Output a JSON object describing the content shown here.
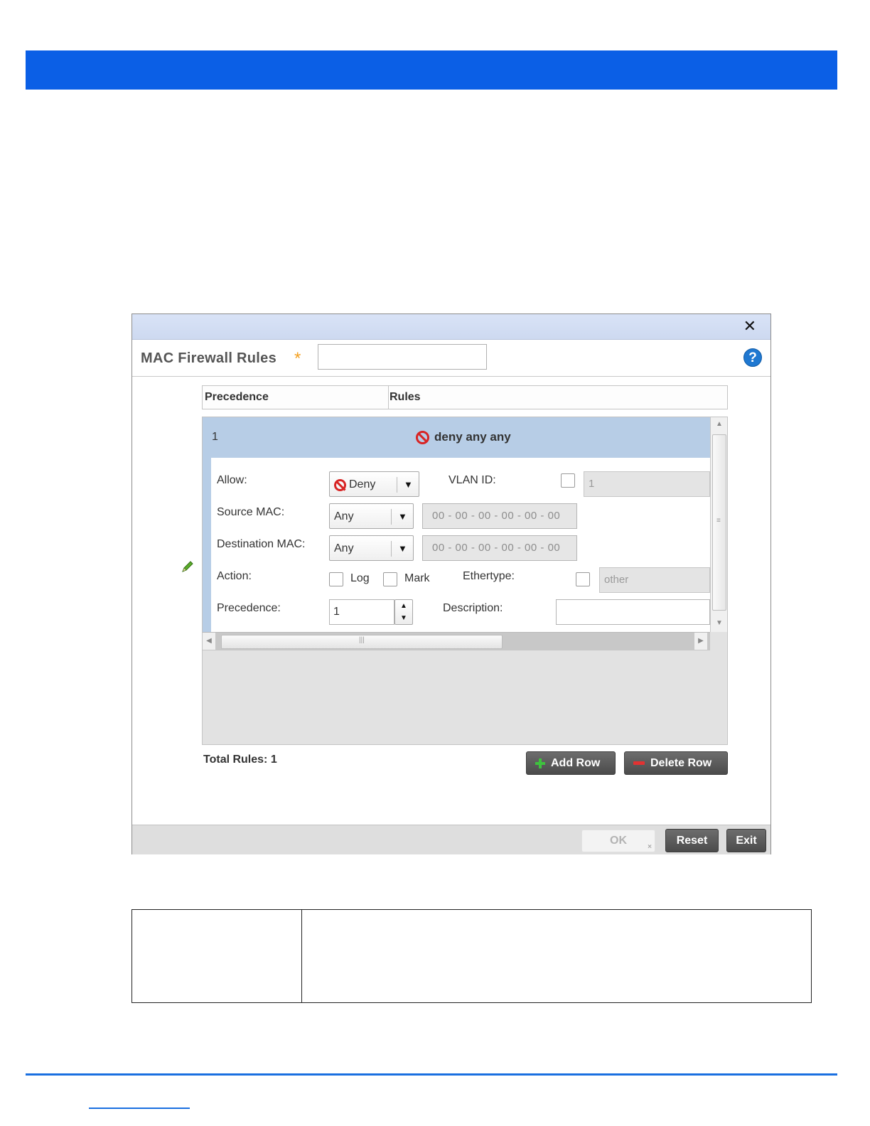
{
  "dialog": {
    "close_glyph": "✕",
    "title": "MAC Firewall Rules",
    "required_mark": "*",
    "name_value": "",
    "help_glyph": "?"
  },
  "grid": {
    "columns": [
      "Precedence",
      "Rules"
    ],
    "row": {
      "precedence": "1",
      "rule_summary": "deny any any"
    }
  },
  "editor": {
    "allow_label": "Allow:",
    "allow_value": "Deny",
    "vlan_label": "VLAN ID:",
    "vlan_value": "1",
    "source_mac_label": "Source MAC:",
    "source_mac_value": "Any",
    "source_mac_address": "00 - 00 - 00 - 00 - 00 - 00",
    "dest_mac_label": "Destination MAC:",
    "dest_mac_value": "Any",
    "dest_mac_address": "00 - 00 - 00 - 00 - 00 - 00",
    "action_label": "Action:",
    "log_label": "Log",
    "mark_label": "Mark",
    "ethertype_label": "Ethertype:",
    "ethertype_value": "other",
    "precedence_label": "Precedence:",
    "precedence_value": "1",
    "description_label": "Description:",
    "description_value": ""
  },
  "summary": {
    "total_rules": "Total Rules: 1",
    "add_row": "Add Row",
    "delete_row": "Delete Row"
  },
  "footer": {
    "ok": "OK",
    "reset": "Reset",
    "exit": "Exit"
  },
  "colors": {
    "banner": "#0b5fe6",
    "row_highlight": "#b7cde6",
    "deny": "#d82424",
    "add": "#3ec23e",
    "delete": "#e23232"
  }
}
